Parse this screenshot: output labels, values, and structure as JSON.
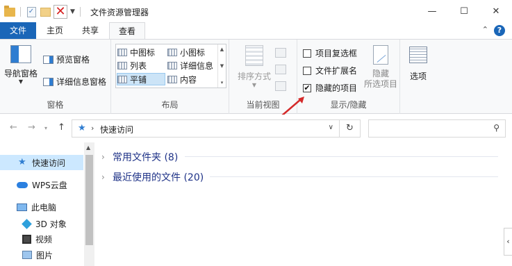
{
  "window": {
    "title": "文件资源管理器",
    "controls": {
      "minimize": "—",
      "maximize": "☐",
      "close": "✕"
    }
  },
  "ribbon_tabs": [
    {
      "label": "文件"
    },
    {
      "label": "主页"
    },
    {
      "label": "共享"
    },
    {
      "label": "查看"
    }
  ],
  "ribbon": {
    "pane": {
      "group_label": "窗格",
      "nav_pane": "导航窗格",
      "preview_pane": "预览窗格",
      "details_pane": "详细信息窗格"
    },
    "layout": {
      "group_label": "布局",
      "items": [
        "中图标",
        "小图标",
        "列表",
        "详细信息",
        "平铺",
        "内容"
      ],
      "selected": "平铺"
    },
    "current_view": {
      "group_label": "当前视图",
      "sort_by": "排序方式"
    },
    "show_hide": {
      "group_label": "显示/隐藏",
      "item_checkboxes": {
        "label": "项目复选框",
        "checked": false
      },
      "file_extensions": {
        "label": "文件扩展名",
        "checked": false
      },
      "hidden_items": {
        "label": "隐藏的项目",
        "checked": true
      },
      "hide_selected_line1": "隐藏",
      "hide_selected_line2": "所选项目"
    },
    "options": {
      "label": "选项"
    }
  },
  "address": {
    "path": "快速访问",
    "search_placeholder": ""
  },
  "nav_pane": {
    "items": [
      {
        "label": "快速访问",
        "icon": "star-icon",
        "selected": true
      },
      {
        "label": "WPS云盘",
        "icon": "cloud-icon"
      },
      {
        "label": "此电脑",
        "icon": "computer-icon"
      },
      {
        "label": "3D 对象",
        "icon": "3d-objects-icon"
      },
      {
        "label": "视频",
        "icon": "video-icon"
      },
      {
        "label": "图片",
        "icon": "pictures-icon"
      }
    ]
  },
  "content": {
    "sections": [
      {
        "label": "常用文件夹 (8)"
      },
      {
        "label": "最近使用的文件 (20)"
      }
    ]
  },
  "colors": {
    "file_tab": "#1a66b8",
    "selection": "#cce8ff",
    "section_text": "#1e3287",
    "annotation_arrow": "#d42a2a"
  }
}
